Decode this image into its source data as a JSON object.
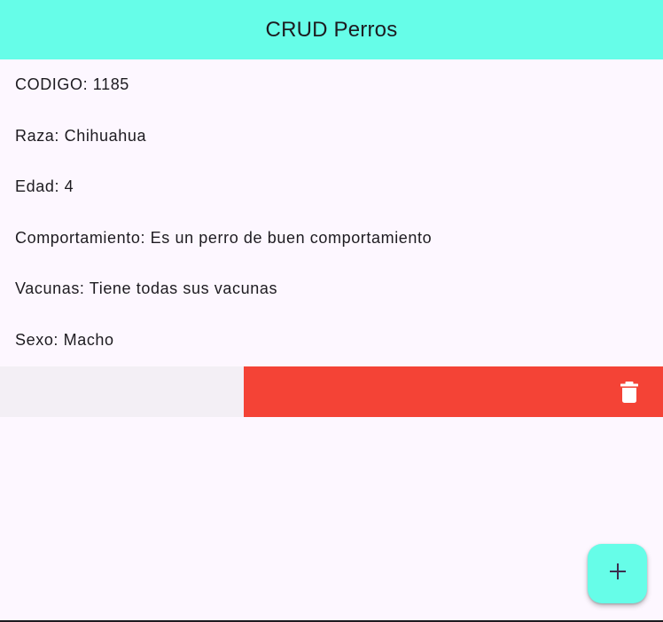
{
  "app_bar": {
    "title": "CRUD Perros"
  },
  "record": {
    "codigo": "CODIGO: 1185",
    "raza": "Raza: Chihuahua",
    "edad": "Edad: 4",
    "comportamiento": "Comportamiento: Es un perro de buen comportamiento",
    "vacunas": "Vacunas: Tiene todas sus vacunas",
    "sexo": "Sexo: Macho"
  },
  "dismiss": {
    "background_color": "#f44336",
    "icon": "trash-icon"
  },
  "fab": {
    "icon": "plus-icon",
    "color": "#66fde8"
  },
  "colors": {
    "app_bar": "#66fde8",
    "page_background": "#fdf7ff",
    "text": "#1d1b20"
  }
}
